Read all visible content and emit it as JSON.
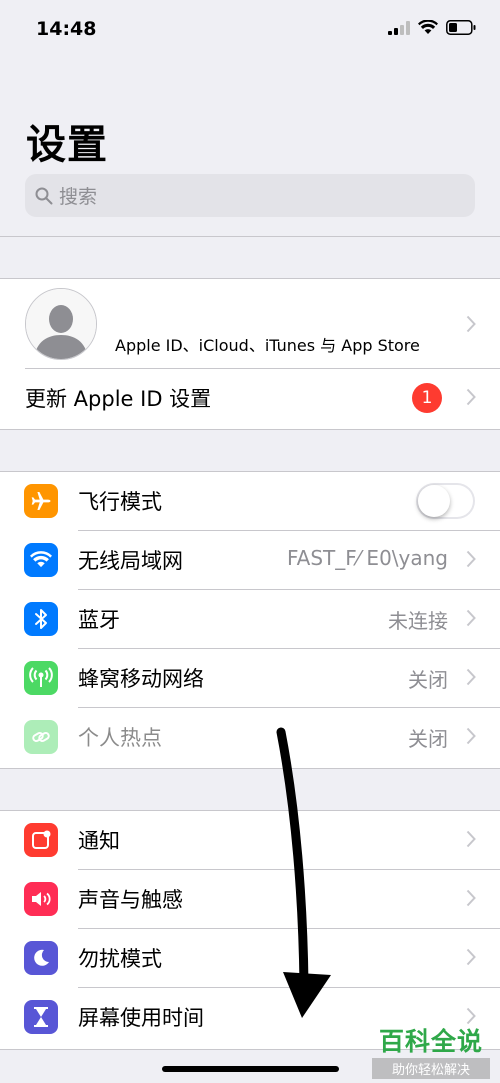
{
  "status_bar": {
    "time": "14:48"
  },
  "header": {
    "title": "设置"
  },
  "search": {
    "placeholder": "搜索"
  },
  "account": {
    "subtitle": "Apple ID、iCloud、iTunes 与 App Store",
    "update_label": "更新 Apple ID 设置",
    "update_badge": "1"
  },
  "connectivity": [
    {
      "label": "飞行模式",
      "icon": "airplane-icon",
      "color": "#ff9500"
    },
    {
      "label": "无线局域网",
      "value": "FAST_F⁄ E0\\yang",
      "icon": "wifi-icon",
      "color": "#007aff"
    },
    {
      "label": "蓝牙",
      "value": "未连接",
      "icon": "bluetooth-icon",
      "color": "#007aff"
    },
    {
      "label": "蜂窝移动网络",
      "value": "关闭",
      "icon": "cellular-icon",
      "color": "#4cd964"
    },
    {
      "label": "个人热点",
      "value": "关闭",
      "icon": "hotspot-icon",
      "color": "#4cd964"
    }
  ],
  "general": [
    {
      "label": "通知",
      "icon": "notifications-icon",
      "color": "#ff3b30"
    },
    {
      "label": "声音与触感",
      "icon": "sound-icon",
      "color": "#ff2d55"
    },
    {
      "label": "勿扰模式",
      "icon": "moon-icon",
      "color": "#5856d6"
    },
    {
      "label": "屏幕使用时间",
      "icon": "hourglass-icon",
      "color": "#5856d6"
    }
  ],
  "watermark": {
    "main": "百科全说",
    "sub": "助你轻松解决"
  }
}
